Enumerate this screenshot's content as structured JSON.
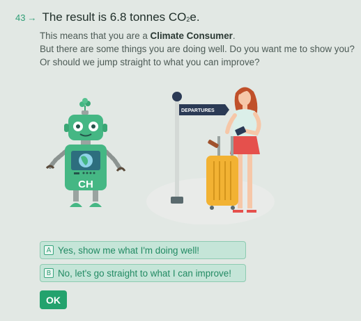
{
  "question": {
    "number": "43",
    "arrow": "→",
    "title_prefix": "The result is 6.8 tonnes CO",
    "title_sub": "2",
    "title_suffix": "e."
  },
  "description": {
    "line1_prefix": "This means that you are a ",
    "line1_bold": "Climate Consumer",
    "line1_suffix": ".",
    "line2": "But there are some things you are doing well. Do you want me to show you?",
    "line3": "Or should we jump straight to what you can improve?"
  },
  "illustration": {
    "sign_text": "DEPARTURES",
    "robot_badge": "CH",
    "colors": {
      "robot_green": "#45b784",
      "suitcase": "#f2b233",
      "dress": "#dbefe9"
    }
  },
  "choices": [
    {
      "key": "A",
      "label": "Yes, show me what I'm doing well!"
    },
    {
      "key": "B",
      "label": "No, let's go straight to what I can improve!"
    }
  ],
  "ok_label": "OK"
}
